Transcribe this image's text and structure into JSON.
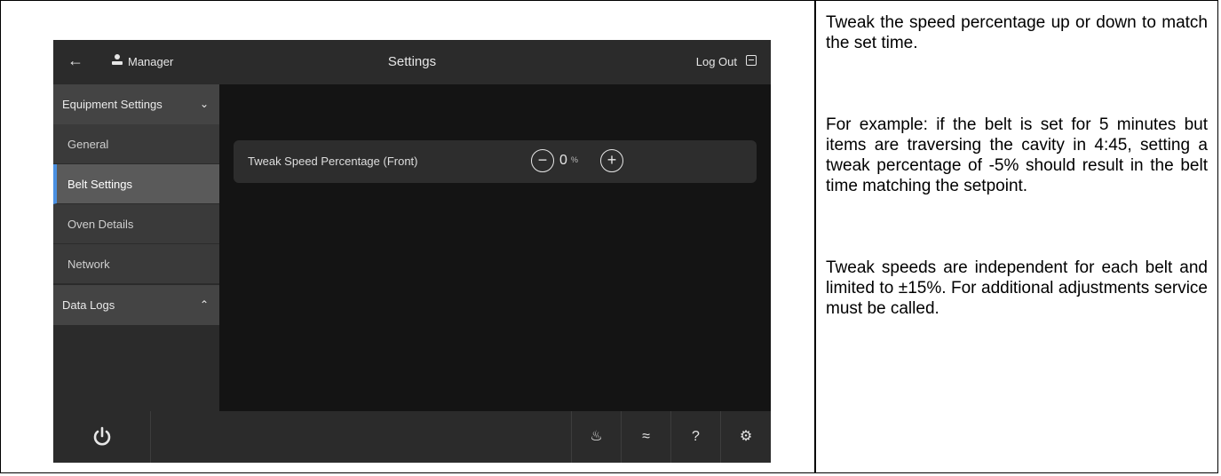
{
  "device": {
    "header": {
      "back_label": "←",
      "user_label": "Manager",
      "title": "Settings",
      "logout_label": "Log Out"
    },
    "sidebar": {
      "groups": [
        {
          "label": "Equipment Settings",
          "chevron": "⌄",
          "items": [
            {
              "label": "General",
              "selected": false
            },
            {
              "label": "Belt Settings",
              "selected": true
            },
            {
              "label": "Oven Details",
              "selected": false
            },
            {
              "label": "Network",
              "selected": false
            }
          ]
        },
        {
          "label": "Data Logs",
          "chevron": "⌃"
        }
      ]
    },
    "setting": {
      "label": "Tweak Speed Percentage (Front)",
      "minus": "−",
      "value": "0",
      "unit": "%",
      "plus": "+"
    },
    "toolbar": {
      "power_icon": "power-icon",
      "icons": [
        "cleaning-icon",
        "heat-icon",
        "help-icon",
        "settings-gear-icon"
      ],
      "glyphs": [
        "♨",
        "≈",
        "?",
        "⚙"
      ]
    },
    "accent_color": "#4a90e2"
  },
  "notes": {
    "p1": "Tweak the speed percentage up or down to match the set time.",
    "p2": "For example: if the belt is set for 5 minutes but items are traversing the cavity in 4:45, setting a tweak percentage of -5% should result in the belt time matching the setpoint.",
    "p3": "Tweak speeds are independent for each belt and limited to ±15%. For additional adjustments service must be called."
  }
}
